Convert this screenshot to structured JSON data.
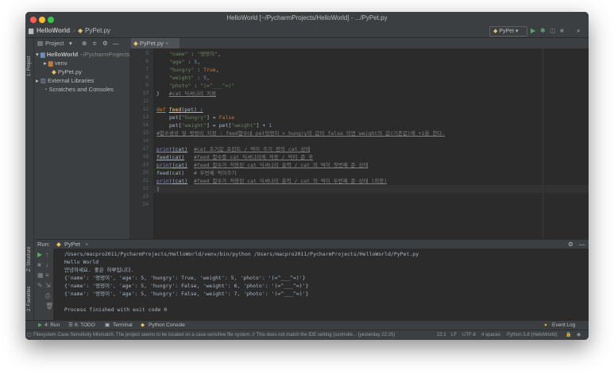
{
  "window": {
    "title": "HelloWorld [~/PycharmProjects/HelloWorld] - .../PyPet.py"
  },
  "navbar": {
    "project": "HelloWorld",
    "file": "PyPet.py",
    "run_config": "PyPet"
  },
  "side_tabs": {
    "project": "1: Project",
    "structure": "Z: Structure",
    "favorites": "2: Favorites"
  },
  "project_panel": {
    "label": "Project",
    "tree": [
      {
        "label": "HelloWorld",
        "extra": "~/PycharmProjects/HelloWorld"
      },
      {
        "label": "venv"
      },
      {
        "label": "PyPet.py"
      },
      {
        "label": "External Libraries"
      },
      {
        "label": "Scratches and Consoles"
      }
    ]
  },
  "editor": {
    "tab_label": "PyPet.py",
    "line_numbers": [
      "5",
      "6",
      "7",
      "8",
      "9",
      "10",
      "11",
      "12",
      "13",
      "14",
      "15",
      "16",
      "17",
      "18",
      "19",
      "20",
      "21",
      "22",
      "23",
      "24"
    ]
  },
  "code": {
    "l5_key": "\"name\"",
    "l5_val": "\"멍멍이\"",
    "l6_key": "\"age\"",
    "l6_val": "5",
    "l7_key": "\"hungry\"",
    "l7_val": "True",
    "l8_key": "\"weight\"",
    "l8_val": "5",
    "l9_key": "\"photo\"",
    "l9_val": "\"(=^___^=)\"",
    "l10_brace": "}",
    "l10_comment": "#cat 딕셔너리 지정",
    "l12_def": "def",
    "l12_fn": "feed",
    "l12_param": "(pet) :",
    "l13_a": "pet[",
    "l13_key": "\"hungry\"",
    "l13_b": "] = ",
    "l13_val": "False",
    "l14_a": "pet[",
    "l14_key": "\"weight\"",
    "l14_b": "] = pet[",
    "l14_key2": "\"weight\"",
    "l14_c": "] + ",
    "l14_num": "1",
    "l15_comment": "#함수생성 및 멍멍이 지정 : feed함수내 pet멍멍이 > hungry의 값이 false 이면 weight의 값(기존값)에 +1을 한다.",
    "l17_print": "print",
    "l17_arg": "(cat)",
    "l17_comment": "#cat 초기값 프린트 / 먹이 주기 전의 cat 상태",
    "l18_fn": "feed(cat)",
    "l18_comment": "#feed 함수를 cat 딕셔너리에 적용 / 먹이 준 후",
    "l19_print": "print",
    "l19_arg": "(cat)",
    "l19_comment": "#feed 함수가 적용된 cat 딕셔너리 출력 / cat 의 먹이 첫번째 준 상태",
    "l20_fn": "feed(cat)",
    "l20_comment": "# 두번째 먹이주기",
    "l21_print": "print",
    "l21_arg": "(cat)",
    "l21_comment": "#feed 함수가 적용된 cat 딕셔너리 출력 / cat 의 먹이 두번째 준 상태 (최종)"
  },
  "run_panel": {
    "label": "Run:",
    "config": "PyPet",
    "output": [
      "/Users/macpro2011/PycharmProjects/HelloWorld/venv/bin/python /Users/macpro2011/PycharmProjects/HelloWorld/PyPet.py",
      "Hello World",
      "안녕하세요. 좋은 하루입니다.",
      "{'name': '멍멍이', 'age': 5, 'hungry': True, 'weight': 5, 'photo': '(=^___^=)'}",
      "{'name': '멍멍이', 'age': 5, 'hungry': False, 'weight': 6, 'photo': '(=^___^=)'}",
      "{'name': '멍멍이', 'age': 5, 'hungry': False, 'weight': 7, 'photo': '(=^___^=)'}",
      "",
      "Process finished with exit code 0"
    ]
  },
  "bottom_tabs": {
    "run": "4: Run",
    "todo": "6: TODO",
    "terminal": "Terminal",
    "python_console": "Python Console",
    "event_log": "Event Log"
  },
  "status": {
    "message": "Filesystem Case-Sensitivity Mismatch: The project seems to be located on a case-sensitive file system. // This does not match the IDE setting (controlle... (yesterday 22:25)",
    "position": "22:1",
    "line_sep": "LF",
    "encoding": "UTF-8",
    "indent": "4 spaces",
    "interpreter": "Python 3.8 (HelloWorld)"
  },
  "colors": {
    "close": "#fc5f57",
    "minimize": "#fdbc2e",
    "zoom": "#34c84a",
    "run_green": "#59a869",
    "keyword": "#cc7832",
    "string": "#6a8759",
    "number": "#6897bb",
    "comment": "#808080"
  }
}
